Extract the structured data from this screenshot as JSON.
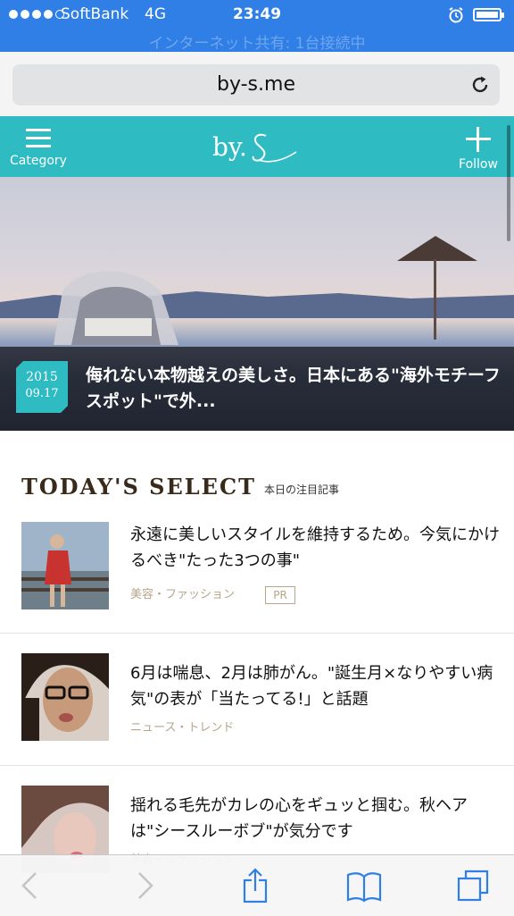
{
  "status_bar": {
    "carrier": "SoftBank",
    "network": "4G",
    "time": "23:49",
    "tether_text": "インターネット共有: 1台接続中"
  },
  "address_bar": {
    "url": "by-s.me"
  },
  "site_header": {
    "category_label": "Category",
    "logo_text": "by.",
    "follow_label": "Follow"
  },
  "hero": {
    "date_year": "2015",
    "date_md": "09.17",
    "title": "侮れない本物越えの美しさ。日本にある\"海外モチーフスポット\"で外..."
  },
  "section": {
    "title": "TODAY'S SELECT",
    "subtitle": "本日の注目記事"
  },
  "articles": [
    {
      "title": "永遠に美しいスタイルを維持するため。今気にかけるべき\"たった3つの事\"",
      "category": "美容・ファッション",
      "badge": "PR"
    },
    {
      "title": "6月は喘息、2月は肺がん。\"誕生月×なりやすい病気\"の表が「当たってる!」と話題",
      "category": "ニュース・トレンド"
    },
    {
      "title": "揺れる毛先がカレの心をギュッと掴む。秋ヘアは\"シースルーボブ\"が気分です",
      "category": "美容・ファッション"
    }
  ],
  "toolbar": {
    "icons": [
      "back-icon",
      "forward-icon",
      "share-icon",
      "bookmarks-icon",
      "tabs-icon"
    ]
  },
  "colors": {
    "status_bar": "#2f7fe6",
    "brand_teal": "#2ebbc2",
    "category_text": "#b6a68a",
    "ios_blue": "#2f7fe6"
  }
}
